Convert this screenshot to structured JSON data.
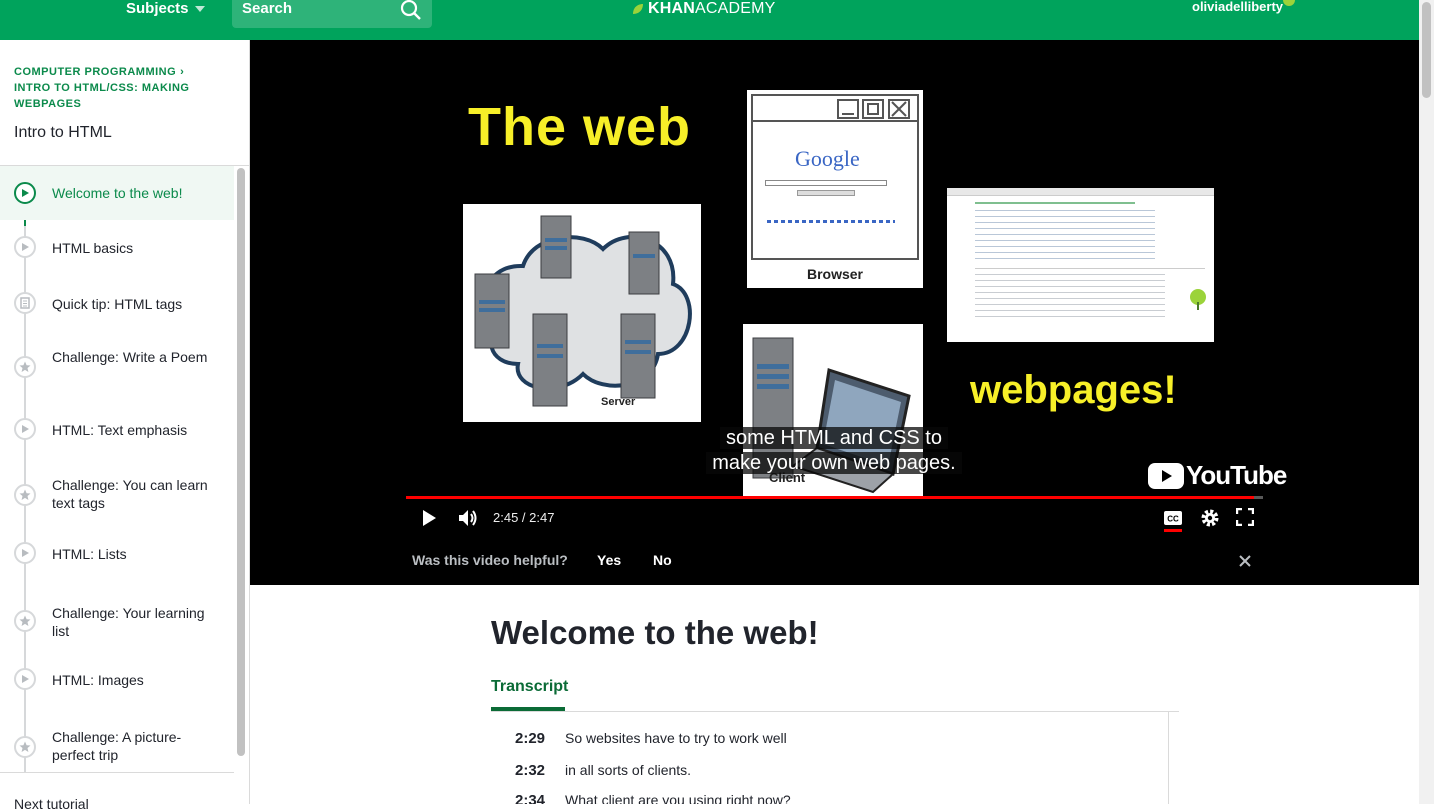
{
  "header": {
    "subjects_label": "Subjects",
    "search_label": "Search",
    "logo_bold": "KHAN",
    "logo_light": "ACADEMY",
    "username": "oliviadelliberty"
  },
  "sidebar": {
    "breadcrumb_course": "COMPUTER PROGRAMMING",
    "breadcrumb_unit": "INTRO TO HTML/CSS: MAKING WEBPAGES",
    "tutorial_title": "Intro to HTML",
    "items": [
      {
        "label": "Welcome to the web!",
        "icon": "play-icon",
        "active": true
      },
      {
        "label": "HTML basics",
        "icon": "play-icon",
        "active": false
      },
      {
        "label": "Quick tip: HTML tags",
        "icon": "article-icon",
        "active": false
      },
      {
        "label": "Challenge: Write a Poem",
        "icon": "star-icon",
        "active": false
      },
      {
        "label": "HTML: Text emphasis",
        "icon": "play-icon",
        "active": false
      },
      {
        "label": "Challenge: You can learn text tags",
        "icon": "star-icon",
        "active": false
      },
      {
        "label": "HTML: Lists",
        "icon": "play-icon",
        "active": false
      },
      {
        "label": "Challenge: Your learning list",
        "icon": "star-icon",
        "active": false
      },
      {
        "label": "HTML: Images",
        "icon": "play-icon",
        "active": false
      },
      {
        "label": "Challenge: A picture-perfect trip",
        "icon": "star-icon",
        "active": false
      }
    ],
    "next_tutorial_label": "Next tutorial"
  },
  "video": {
    "slide_title": "The web",
    "slide_subtitle": "webpages!",
    "browser_label": "Browser",
    "server_label": "Server",
    "client_label": "Client",
    "google_label": "Google",
    "caption_line1": "some HTML and CSS to",
    "caption_line2": "make your own web pages.",
    "youtube_label": "YouTube",
    "time_display": "2:45 / 2:47",
    "progress_fraction": 0.99
  },
  "feedback": {
    "question": "Was this video helpful?",
    "yes_label": "Yes",
    "no_label": "No"
  },
  "content": {
    "title": "Welcome to the web!",
    "tab_label": "Transcript",
    "transcript": [
      {
        "time": "2:29",
        "text": "So websites have to try to work well"
      },
      {
        "time": "2:32",
        "text": "in all sorts of clients."
      },
      {
        "time": "2:34",
        "text": "What client are you using right now?"
      }
    ]
  },
  "colors": {
    "brand_green": "#00a35c",
    "link_green": "#0b8a4b",
    "slide_yellow": "#f7ef28",
    "progress_red": "#ff0000"
  }
}
